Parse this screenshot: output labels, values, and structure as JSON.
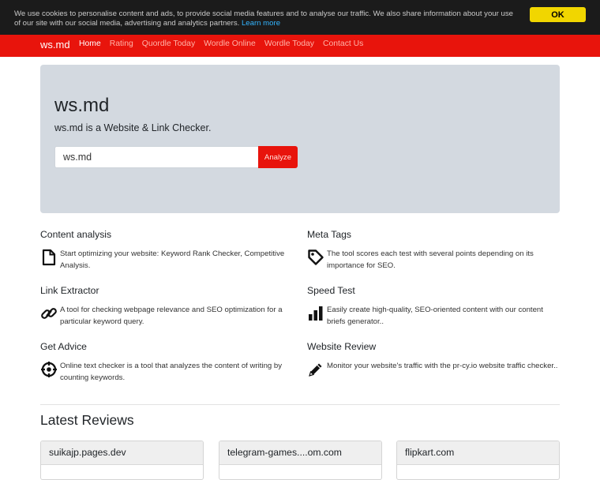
{
  "cookie": {
    "message": "We use cookies to personalise content and ads, to provide social media features and to analyse our traffic. We also share information about your use of our site with our social media, advertising and analytics partners.",
    "link": "Learn more",
    "ok": "OK"
  },
  "nav": {
    "brand": "ws.md",
    "links": [
      "Home",
      "Rating",
      "Quordle Today",
      "Wordle Online",
      "Wordle Today",
      "Contact Us"
    ]
  },
  "hero": {
    "title": "ws.md",
    "subtitle": "ws.md is a Website & Link Checker.",
    "input_value": "ws.md",
    "analyze": "Analyze"
  },
  "features": [
    {
      "title": "Content analysis",
      "icon": "document-icon",
      "text": "Start optimizing your website: Keyword Rank Checker, Competitive Analysis."
    },
    {
      "title": "Meta Tags",
      "icon": "tag-icon",
      "text": "The tool scores each test with several points depending on its importance for SEO."
    },
    {
      "title": "Link Extractor",
      "icon": "link-icon",
      "text": "A tool for checking webpage relevance and SEO optimization for a particular keyword query."
    },
    {
      "title": "Speed Test",
      "icon": "bar-chart-icon",
      "text": "Easily create high-quality, SEO-oriented content with our content briefs generator.."
    },
    {
      "title": "Get Advice",
      "icon": "crosshair-icon",
      "text": "Online text checker is a tool that analyzes the content of writing by counting keywords."
    },
    {
      "title": "Website Review",
      "icon": "pencil-icon",
      "text": "Monitor your website's traffic with the pr-cy.io website traffic checker.."
    }
  ],
  "reviews": {
    "title": "Latest Reviews",
    "cards": [
      "suikajp.pages.dev",
      "telegram-games....om.com",
      "flipkart.com"
    ]
  }
}
